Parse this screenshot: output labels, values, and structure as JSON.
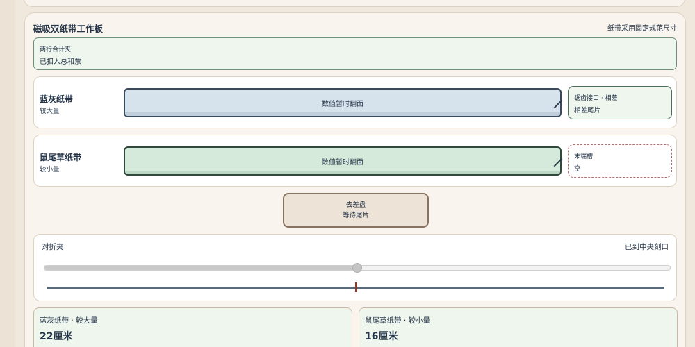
{
  "board": {
    "title": "磁吸双纸带工作板",
    "note": "纸带采用固定规范尺寸"
  },
  "clip": {
    "label": "两行合计夹",
    "status": "已扣入总和票"
  },
  "tapes": [
    {
      "name": "蓝灰纸带",
      "sub": "较大量",
      "bar_text": "数值暂时翻面",
      "color": "#d6e2ec",
      "slot": {
        "label": "锯齿接口 · 相差",
        "value": "相差尾片",
        "state": "filled"
      }
    },
    {
      "name": "鼠尾草纸带",
      "sub": "较小量",
      "bar_text": "数值暂时翻面",
      "color": "#d5eadb",
      "slot": {
        "label": "末端槽",
        "value": "空",
        "state": "empty"
      }
    }
  ],
  "tray": {
    "label": "去差盘",
    "status": "等待尾片"
  },
  "fold": {
    "label": "对折夹",
    "status": "已到中央刻口",
    "slider_value": 0.5
  },
  "results": [
    {
      "label": "蓝灰纸带 · 较大量",
      "value": "22厘米"
    },
    {
      "label": "鼠尾草纸带 · 较小量",
      "value": "16厘米"
    }
  ]
}
